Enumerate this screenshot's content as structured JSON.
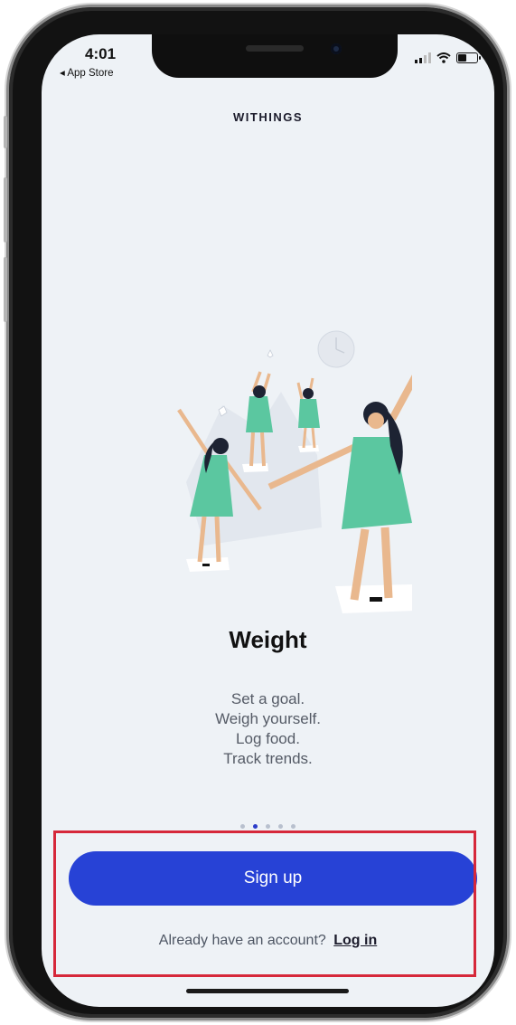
{
  "status_bar": {
    "time": "4:01",
    "back_label": "◂ App Store",
    "icons": [
      "cellular-signal-icon",
      "wifi-icon",
      "battery-icon"
    ]
  },
  "header": {
    "brand": "WITHINGS"
  },
  "onboarding": {
    "title": "Weight",
    "description_lines": [
      "Set a goal.",
      "Weigh yourself.",
      "Log food.",
      "Track trends."
    ],
    "page_count": 5,
    "active_page": 2
  },
  "actions": {
    "signup_label": "Sign up",
    "login_prompt": "Already have an account?",
    "login_label": "Log in"
  },
  "colors": {
    "background": "#eef2f6",
    "primary_button": "#2742d6",
    "active_dot": "#2c3cc9",
    "dress": "#5bc7a0",
    "highlight_box": "#d6283a"
  }
}
